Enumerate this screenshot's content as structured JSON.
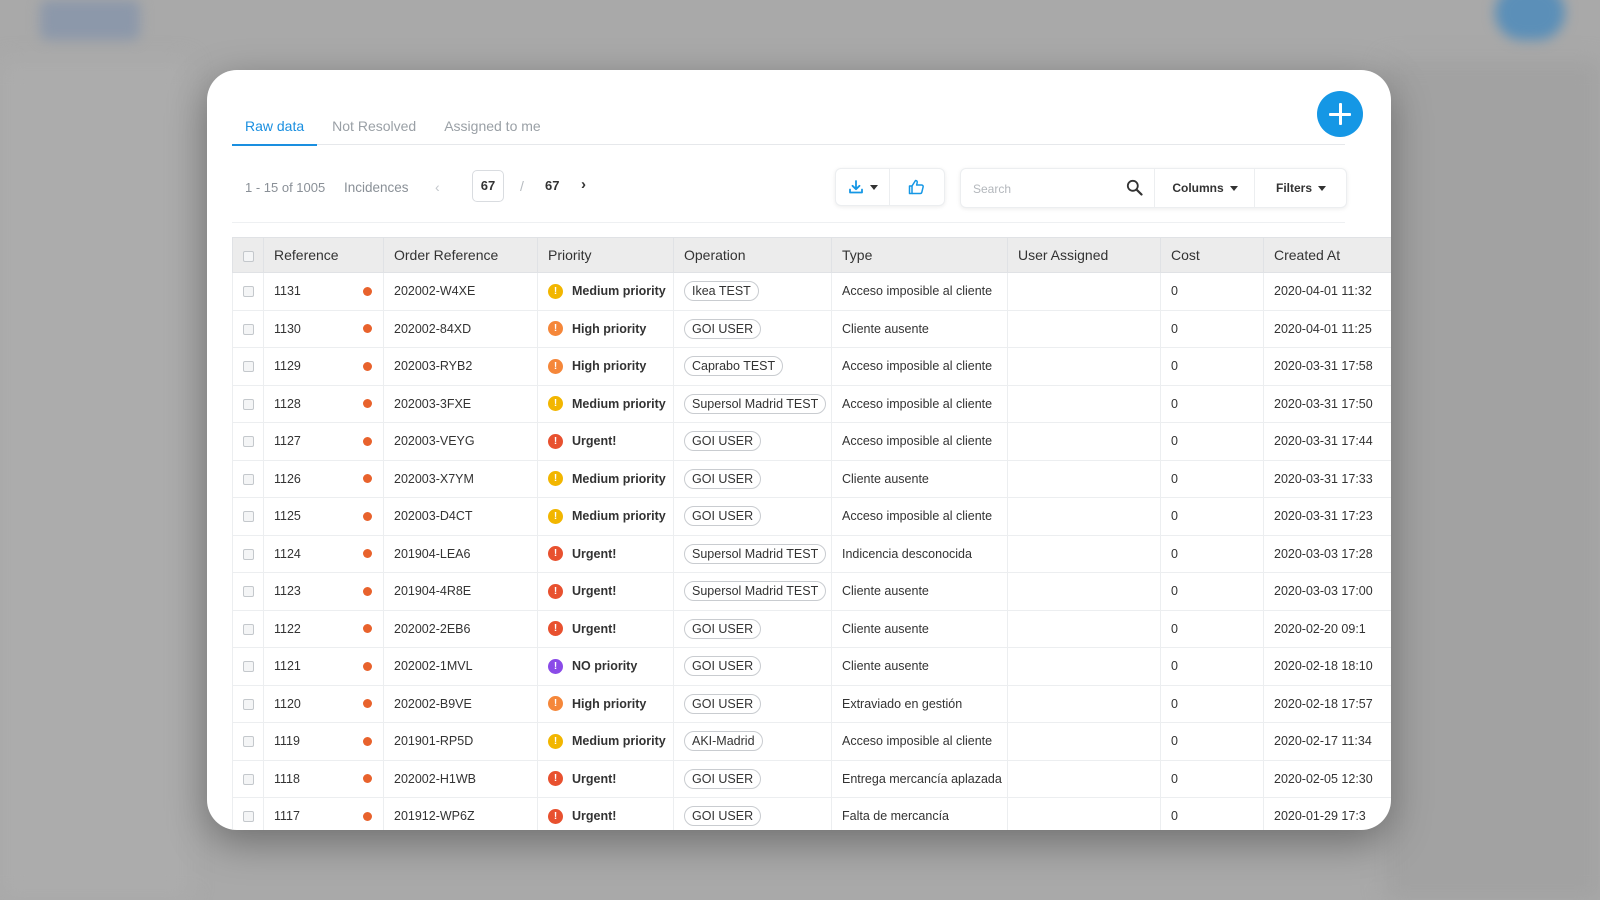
{
  "tabs": [
    "Raw data",
    "Not Resolved",
    "Assigned to me"
  ],
  "active_tab": 0,
  "pagination": {
    "range": "1 - 15 of 1005",
    "entity": "Incidences",
    "prev": "‹",
    "current_page": "67",
    "separator": "/",
    "total_pages": "67",
    "next": "›"
  },
  "toolbar": {
    "search_placeholder": "Search",
    "columns_label": "Columns",
    "filters_label": "Filters"
  },
  "colors": {
    "accent": "#1a8fe0",
    "fab": "#1597e5",
    "ref_dot": "#e8622c",
    "priority": {
      "Medium priority": "#f2b600",
      "High priority": "#f5873a",
      "Urgent!": "#e8512f",
      "NO priority": "#8a4be8"
    }
  },
  "table": {
    "headers": [
      "Reference",
      "Order Reference",
      "Priority",
      "Operation",
      "Type",
      "User Assigned",
      "Cost",
      "Created At"
    ],
    "rows": [
      {
        "ref": "1131",
        "order": "202002-W4XE",
        "priority": "Medium priority",
        "operation": "Ikea TEST",
        "type": "Acceso imposible al cliente",
        "user": "",
        "cost": "0",
        "created": "2020-04-01 11:32"
      },
      {
        "ref": "1130",
        "order": "202002-84XD",
        "priority": "High priority",
        "operation": "GOI USER",
        "type": "Cliente ausente",
        "user": "",
        "cost": "0",
        "created": "2020-04-01 11:25"
      },
      {
        "ref": "1129",
        "order": "202003-RYB2",
        "priority": "High priority",
        "operation": "Caprabo TEST",
        "type": "Acceso imposible al cliente",
        "user": "",
        "cost": "0",
        "created": "2020-03-31 17:58"
      },
      {
        "ref": "1128",
        "order": "202003-3FXE",
        "priority": "Medium priority",
        "operation": "Supersol Madrid TEST",
        "type": "Acceso imposible al cliente",
        "user": "",
        "cost": "0",
        "created": "2020-03-31 17:50"
      },
      {
        "ref": "1127",
        "order": "202003-VEYG",
        "priority": "Urgent!",
        "operation": "GOI USER",
        "type": "Acceso imposible al cliente",
        "user": "",
        "cost": "0",
        "created": "2020-03-31 17:44"
      },
      {
        "ref": "1126",
        "order": "202003-X7YM",
        "priority": "Medium priority",
        "operation": "GOI USER",
        "type": "Cliente ausente",
        "user": "",
        "cost": "0",
        "created": "2020-03-31 17:33"
      },
      {
        "ref": "1125",
        "order": "202003-D4CT",
        "priority": "Medium priority",
        "operation": "GOI USER",
        "type": "Acceso imposible al cliente",
        "user": "",
        "cost": "0",
        "created": "2020-03-31 17:23"
      },
      {
        "ref": "1124",
        "order": "201904-LEA6",
        "priority": "Urgent!",
        "operation": "Supersol Madrid TEST",
        "type": "Indicencia desconocida",
        "user": "",
        "cost": "0",
        "created": "2020-03-03 17:28"
      },
      {
        "ref": "1123",
        "order": "201904-4R8E",
        "priority": "Urgent!",
        "operation": "Supersol Madrid TEST",
        "type": "Cliente ausente",
        "user": "",
        "cost": "0",
        "created": "2020-03-03 17:00"
      },
      {
        "ref": "1122",
        "order": "202002-2EB6",
        "priority": "Urgent!",
        "operation": "GOI USER",
        "type": "Cliente ausente",
        "user": "",
        "cost": "0",
        "created": "2020-02-20 09:1"
      },
      {
        "ref": "1121",
        "order": "202002-1MVL",
        "priority": "NO priority",
        "operation": "GOI USER",
        "type": "Cliente ausente",
        "user": "",
        "cost": "0",
        "created": "2020-02-18 18:10"
      },
      {
        "ref": "1120",
        "order": "202002-B9VE",
        "priority": "High priority",
        "operation": "GOI USER",
        "type": "Extraviado en gestión",
        "user": "",
        "cost": "0",
        "created": "2020-02-18 17:57"
      },
      {
        "ref": "1119",
        "order": "201901-RP5D",
        "priority": "Medium priority",
        "operation": "AKI-Madrid",
        "type": "Acceso imposible al cliente",
        "user": "",
        "cost": "0",
        "created": "2020-02-17 11:34"
      },
      {
        "ref": "1118",
        "order": "202002-H1WB",
        "priority": "Urgent!",
        "operation": "GOI USER",
        "type": "Entrega mercancía aplazada",
        "user": "",
        "cost": "0",
        "created": "2020-02-05 12:30"
      },
      {
        "ref": "1117",
        "order": "201912-WP6Z",
        "priority": "Urgent!",
        "operation": "GOI USER",
        "type": "Falta de mercancía",
        "user": "",
        "cost": "0",
        "created": "2020-01-29 17:3"
      }
    ]
  }
}
